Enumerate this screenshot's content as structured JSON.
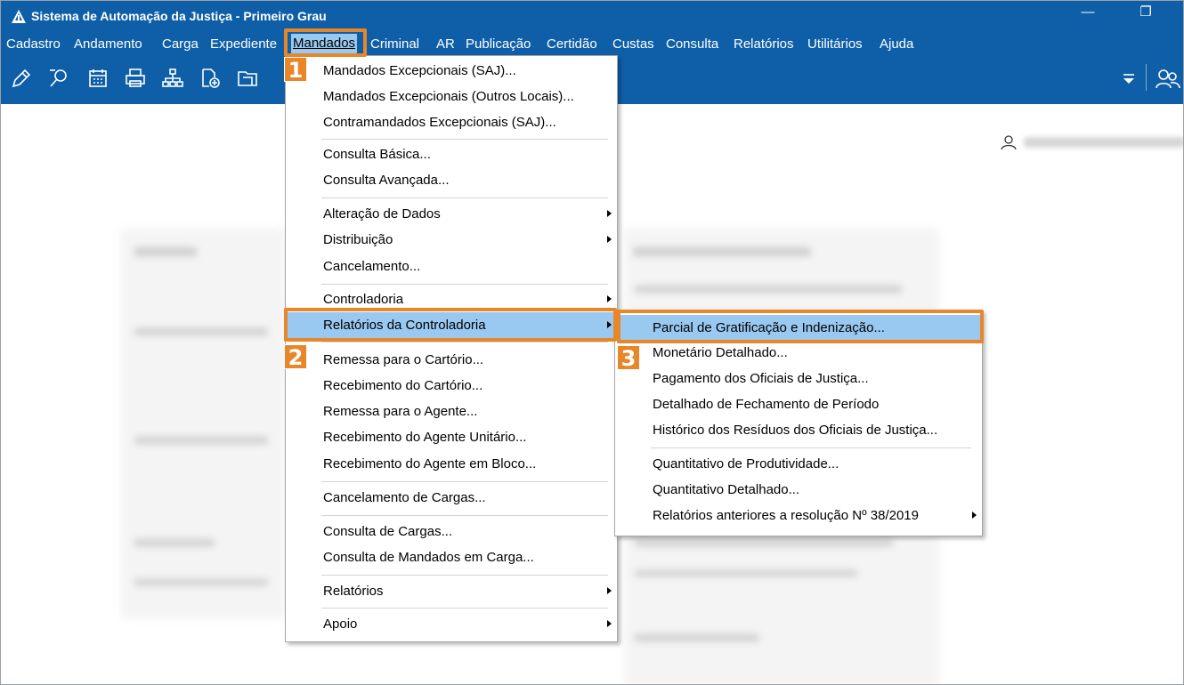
{
  "window": {
    "title": "Sistema de Automação da Justiça - Primeiro Grau",
    "minimize": "—",
    "restore": "❐"
  },
  "menubar": [
    "Cadastro",
    "Andamento",
    "Carga",
    "Expediente",
    "Mandados",
    "Criminal",
    "AR",
    "Publicação",
    "Certidão",
    "Custas",
    "Consulta",
    "Relatórios",
    "Utilitários",
    "Ajuda"
  ],
  "toolbar_icons": [
    "edit-icon",
    "search-document-icon",
    "calendar-icon",
    "printer-icon",
    "hierarchy-icon",
    "add-document-icon",
    "folder-icon"
  ],
  "mandados_menu": [
    {
      "label": "Mandados Excepcionais (SAJ)...",
      "submenu": false
    },
    {
      "label": "Mandados Excepcionais (Outros Locais)...",
      "submenu": false
    },
    {
      "label": "Contramandados Excepcionais (SAJ)...",
      "submenu": false
    },
    {
      "label": "Consulta Básica...",
      "submenu": false
    },
    {
      "label": "Consulta Avançada...",
      "submenu": false
    },
    {
      "label": "Alteração de Dados",
      "submenu": true
    },
    {
      "label": "Distribuição",
      "submenu": true
    },
    {
      "label": "Cancelamento...",
      "submenu": false
    },
    {
      "label": "Controladoria",
      "submenu": true
    },
    {
      "label": "Relatórios da Controladoria",
      "submenu": true
    },
    {
      "label": "Remessa para o Cartório...",
      "submenu": false
    },
    {
      "label": "Recebimento do Cartório...",
      "submenu": false
    },
    {
      "label": "Remessa para o Agente...",
      "submenu": false
    },
    {
      "label": "Recebimento do Agente Unitário...",
      "submenu": false
    },
    {
      "label": "Recebimento do Agente em Bloco...",
      "submenu": false
    },
    {
      "label": "Cancelamento de Cargas...",
      "submenu": false
    },
    {
      "label": "Consulta de Cargas...",
      "submenu": false
    },
    {
      "label": "Consulta de Mandados em Carga...",
      "submenu": false
    },
    {
      "label": "Relatórios",
      "submenu": true
    },
    {
      "label": "Apoio",
      "submenu": true
    }
  ],
  "controladoria_submenu": [
    {
      "label": "Parcial de Gratificação e Indenização...",
      "submenu": false
    },
    {
      "label": "Monetário Detalhado...",
      "submenu": false
    },
    {
      "label": "Pagamento dos Oficiais de Justiça...",
      "submenu": false
    },
    {
      "label": "Detalhado de Fechamento de Período",
      "submenu": false
    },
    {
      "label": "Histórico dos Resíduos dos Oficiais de Justiça...",
      "submenu": false
    },
    {
      "label": "Quantitativo de Produtividade...",
      "submenu": false
    },
    {
      "label": "Quantitativo Detalhado...",
      "submenu": false
    },
    {
      "label": "Relatórios anteriores a resolução Nº 38/2019",
      "submenu": true
    }
  ],
  "badges": [
    "1",
    "2",
    "3"
  ],
  "accent_color": "#e8862a",
  "titlebar_color": "#0f5fa8",
  "highlight_color": "#99c8f0"
}
